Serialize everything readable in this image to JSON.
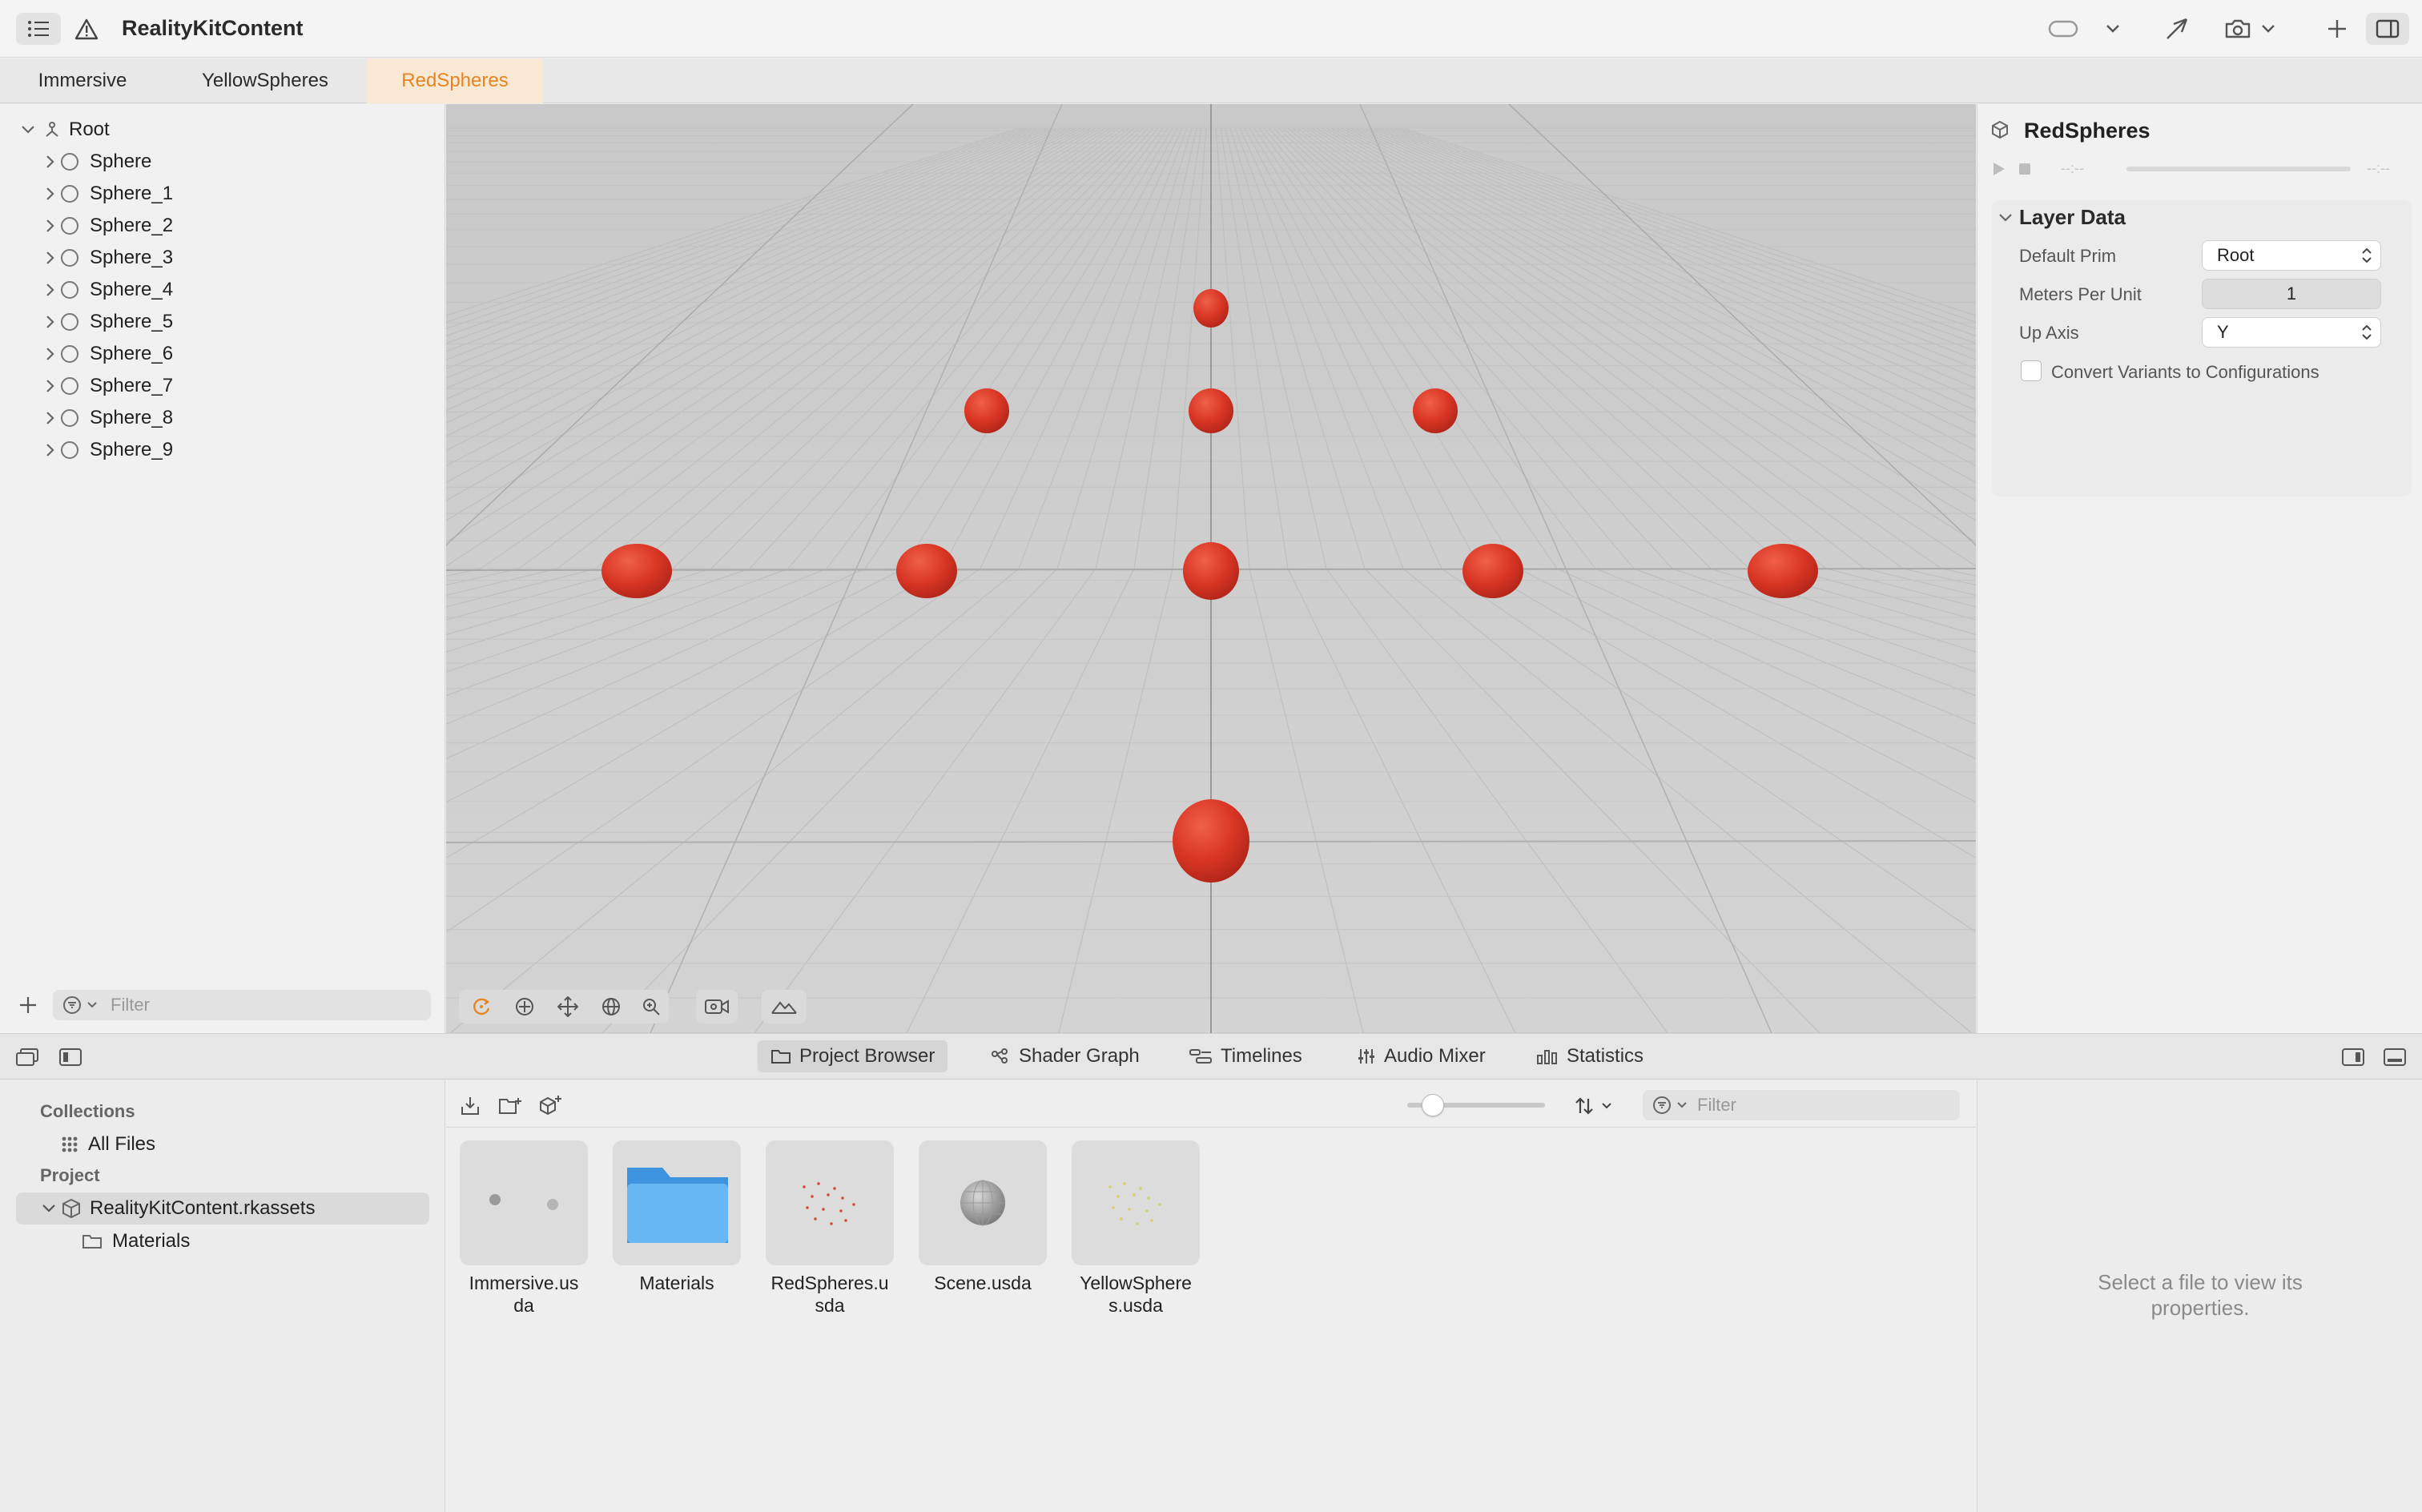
{
  "toolbar": {
    "title": "RealityKitContent"
  },
  "tabs": [
    {
      "label": "Immersive"
    },
    {
      "label": "YellowSpheres"
    },
    {
      "label": "RedSpheres",
      "active": true
    }
  ],
  "outline": {
    "root": "Root",
    "items": [
      "Sphere",
      "Sphere_1",
      "Sphere_2",
      "Sphere_3",
      "Sphere_4",
      "Sphere_5",
      "Sphere_6",
      "Sphere_7",
      "Sphere_8",
      "Sphere_9"
    ],
    "filter_placeholder": "Filter"
  },
  "inspector": {
    "title": "RedSpheres",
    "time_start": "--:--",
    "time_end": "--:--",
    "section": "Layer Data",
    "default_prim_label": "Default Prim",
    "default_prim_value": "Root",
    "meters_label": "Meters Per Unit",
    "meters_value": "1",
    "up_axis_label": "Up Axis",
    "up_axis_value": "Y",
    "convert_label": "Convert Variants to Configurations"
  },
  "bottom_tabs": [
    {
      "label": "Project Browser",
      "active": true
    },
    {
      "label": "Shader Graph"
    },
    {
      "label": "Timelines"
    },
    {
      "label": "Audio Mixer"
    },
    {
      "label": "Statistics"
    }
  ],
  "collections": {
    "header": "Collections",
    "all_files": "All Files",
    "project_header": "Project",
    "project_item": "RealityKitContent.rkassets",
    "materials": "Materials"
  },
  "browser": {
    "filter_placeholder": "Filter",
    "files": [
      {
        "name": "Immersive.us\nda"
      },
      {
        "name": "Materials"
      },
      {
        "name": "RedSpheres.u\nsda"
      },
      {
        "name": "Scene.usda"
      },
      {
        "name": "YellowSphere\ns.usda"
      }
    ]
  },
  "file_props": {
    "empty_text": "Select a file to view its properties."
  },
  "colors": {
    "accent": "#e8841f",
    "sphere": "#d93524",
    "folder": "#5aaef0"
  }
}
